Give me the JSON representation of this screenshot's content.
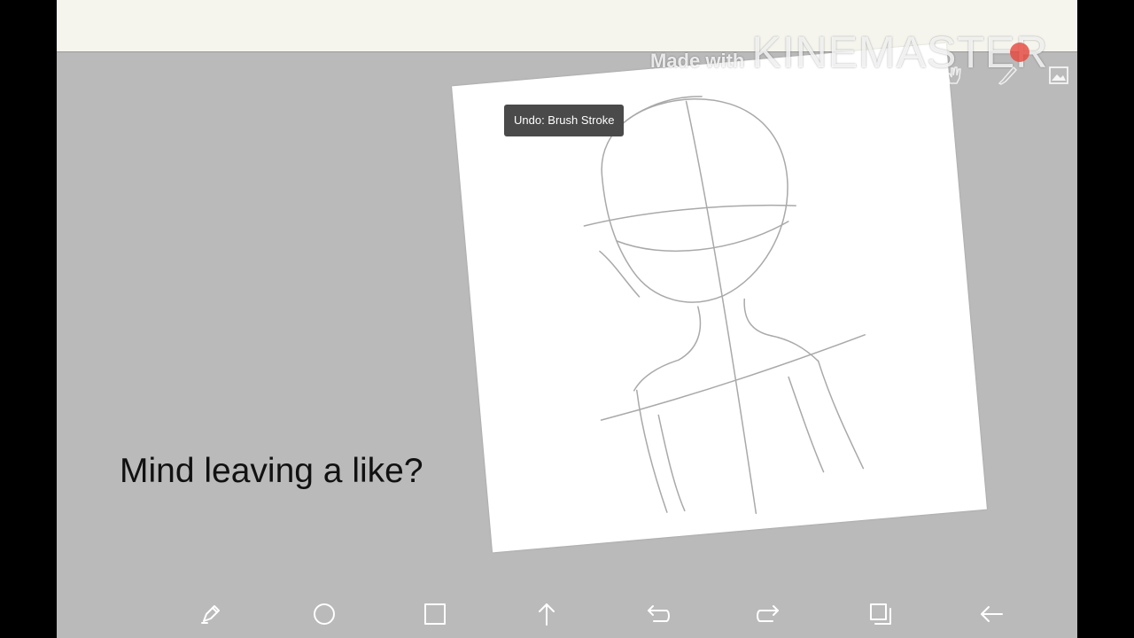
{
  "tooltip": {
    "text": "Undo: Brush Stroke"
  },
  "caption": {
    "text": "Mind leaving a like?"
  },
  "watermark": {
    "prefix": "Made with",
    "brand": "KINEMASTER"
  },
  "colors": {
    "background": "#bababa",
    "topbar": "#f5f5ee",
    "canvas": "#ffffff",
    "sketch_stroke": "#a9a9a9",
    "tooltip_bg": "#4a4a4a"
  },
  "toolbar_icons": [
    "selection-icon",
    "hand-icon",
    "brush-icon",
    "layer-image-icon"
  ],
  "navbar_icons": [
    "edit-icon",
    "home-circle-icon",
    "recents-square-icon",
    "up-arrow-icon",
    "undo-icon",
    "redo-icon",
    "layers-icon",
    "back-arrow-icon"
  ]
}
